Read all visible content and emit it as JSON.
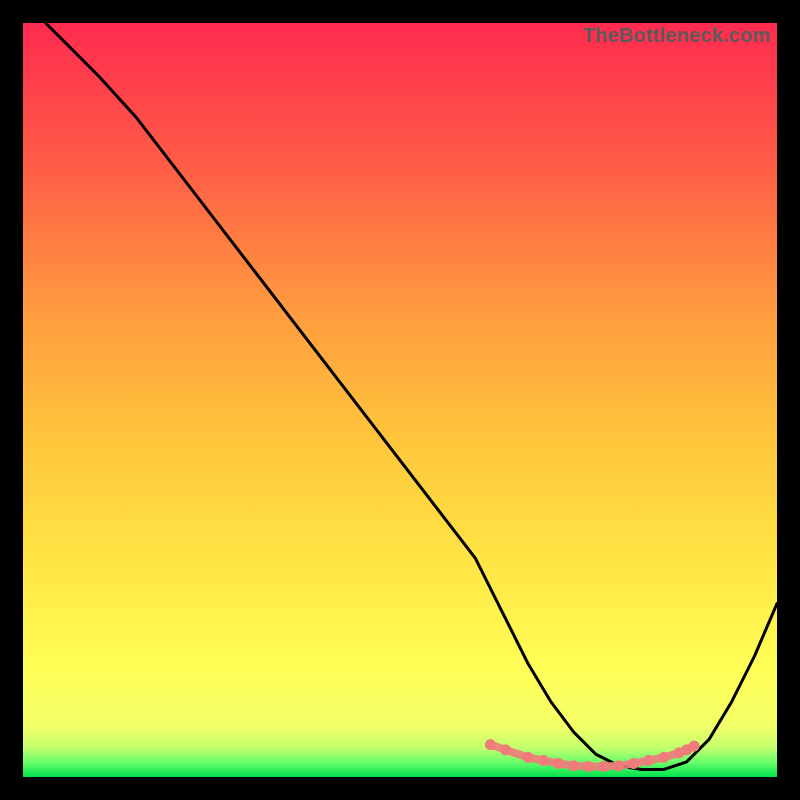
{
  "watermark": "TheBottleneck.com",
  "chart_data": {
    "type": "line",
    "title": "",
    "xlabel": "",
    "ylabel": "",
    "xlim": [
      0,
      100
    ],
    "ylim": [
      0,
      100
    ],
    "grid": false,
    "legend": false,
    "background_gradient": {
      "top": "#ff2b4f",
      "mid_upper": "#ff8a3d",
      "mid": "#ffd23a",
      "mid_lower": "#ffff55",
      "green_band": "#4bff6a",
      "bottom": "#00e24e"
    },
    "series": [
      {
        "name": "curve",
        "color": "#000000",
        "x": [
          3,
          6,
          10,
          15,
          20,
          25,
          30,
          35,
          40,
          45,
          50,
          55,
          60,
          62,
          64,
          67,
          70,
          73,
          76,
          79,
          82,
          85,
          88,
          91,
          94,
          97,
          100
        ],
        "y": [
          100,
          97,
          93,
          87.5,
          81,
          74.5,
          68,
          61.5,
          55,
          48.5,
          42,
          35.5,
          29,
          25,
          21,
          15,
          10,
          6,
          3,
          1.5,
          1,
          1,
          2,
          5,
          10,
          16,
          23
        ]
      },
      {
        "name": "highlight-dots",
        "color": "#ef7b7b",
        "x": [
          62,
          64,
          67,
          69,
          71,
          73,
          75,
          77,
          79,
          81,
          83,
          85,
          87,
          88,
          89
        ],
        "y": [
          4.3,
          3.6,
          2.6,
          2.2,
          1.8,
          1.5,
          1.4,
          1.4,
          1.5,
          1.8,
          2.2,
          2.6,
          3.2,
          3.6,
          4.1
        ]
      }
    ]
  }
}
